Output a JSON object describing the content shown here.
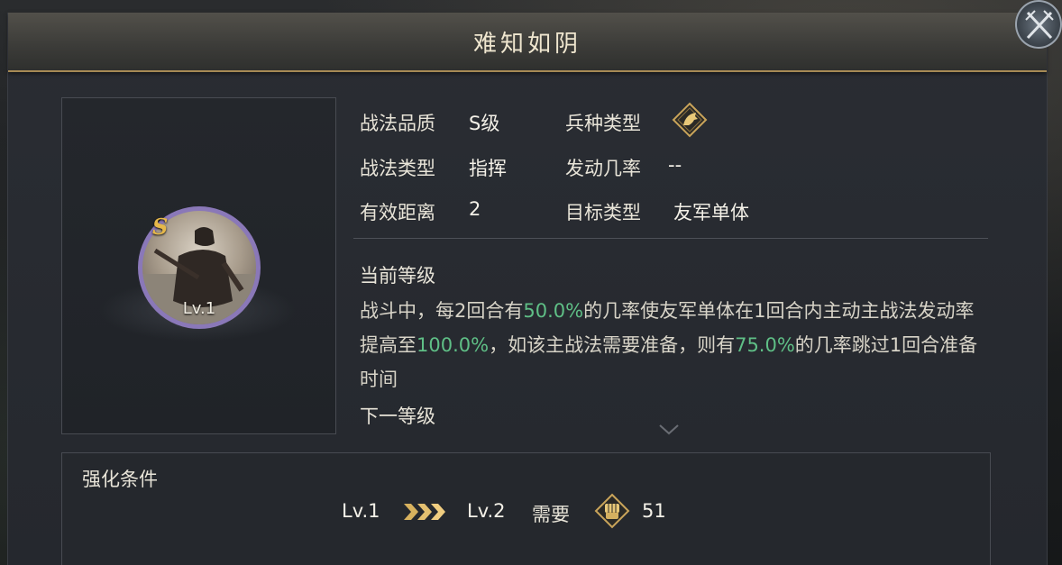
{
  "dialog": {
    "title": "难知如阴"
  },
  "skill": {
    "grade_badge": "S",
    "level_badge": "Lv.1"
  },
  "stats": {
    "quality_label": "战法品质",
    "quality_value": "S级",
    "troop_label": "兵种类型",
    "troop_icon": "horse-cavalry-icon",
    "type_label": "战法类型",
    "type_value": "指挥",
    "chance_label": "发动几率",
    "chance_value": "--",
    "range_label": "有效距离",
    "range_value": "2",
    "target_label": "目标类型",
    "target_value": "友军单体"
  },
  "description": {
    "current_level_label": "当前等级",
    "seg1": "战斗中，每2回合有",
    "hl1": "50.0%",
    "seg2": "的几率使友军单体在1回合内主动主战法发动率提高至",
    "hl2": "100.0%",
    "seg3": "，如该主战法需要准备，则有",
    "hl3": "75.0%",
    "seg4": "的几率跳过1回合准备时间",
    "next_level_label": "下一等级"
  },
  "enhance": {
    "title": "强化条件",
    "from_level": "Lv.1",
    "to_level": "Lv.2",
    "need_label": "需要",
    "cost_icon": "fist-token-icon",
    "cost_value": "51"
  },
  "colors": {
    "accent_gold": "#a68a55",
    "highlight_green": "#5fbf86",
    "portrait_ring": "#8a78b8",
    "grade_gold": "#e6b84a"
  }
}
